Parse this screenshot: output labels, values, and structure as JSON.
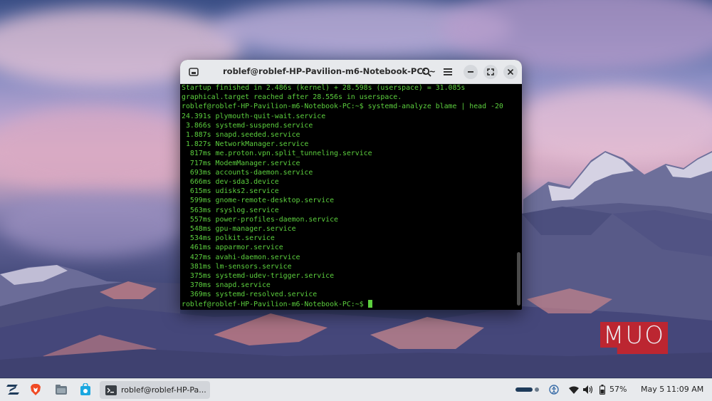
{
  "terminal": {
    "title": "roblef@roblef-HP-Pavilion-m6-Notebook-PC: ~",
    "lines": [
      "Startup finished in 2.486s (kernel) + 28.598s (userspace) = 31.085s",
      "graphical.target reached after 28.556s in userspace.",
      "roblef@roblef-HP-Pavilion-m6-Notebook-PC:~$ systemd-analyze blame | head -20",
      "24.391s plymouth-quit-wait.service",
      " 3.866s systemd-suspend.service",
      " 1.887s snapd.seeded.service",
      " 1.827s NetworkManager.service",
      "  817ms me.proton.vpn.split_tunneling.service",
      "  717ms ModemManager.service",
      "  693ms accounts-daemon.service",
      "  666ms dev-sda3.device",
      "  615ms udisks2.service",
      "  599ms gnome-remote-desktop.service",
      "  563ms rsyslog.service",
      "  557ms power-profiles-daemon.service",
      "  548ms gpu-manager.service",
      "  534ms polkit.service",
      "  461ms apparmor.service",
      "  427ms avahi-daemon.service",
      "  381ms lm-sensors.service",
      "  375ms systemd-udev-trigger.service",
      "  370ms snapd.service",
      "  369ms systemd-resolved.service"
    ],
    "prompt": "roblef@roblef-HP-Pavilion-m6-Notebook-PC:~$ ",
    "text_color": "#5ccf3e",
    "background": "#000000"
  },
  "taskbar": {
    "active_task_label": "roblef@roblef-HP-Pa...",
    "battery": "57%",
    "date": "May 5",
    "time": "11:09 AM"
  },
  "watermark": "MUO",
  "icons": {
    "launcher": "zorin-logo-icon",
    "browser": "brave-browser-icon",
    "files": "files-icon",
    "store": "software-store-icon",
    "terminal": "terminal-icon"
  }
}
